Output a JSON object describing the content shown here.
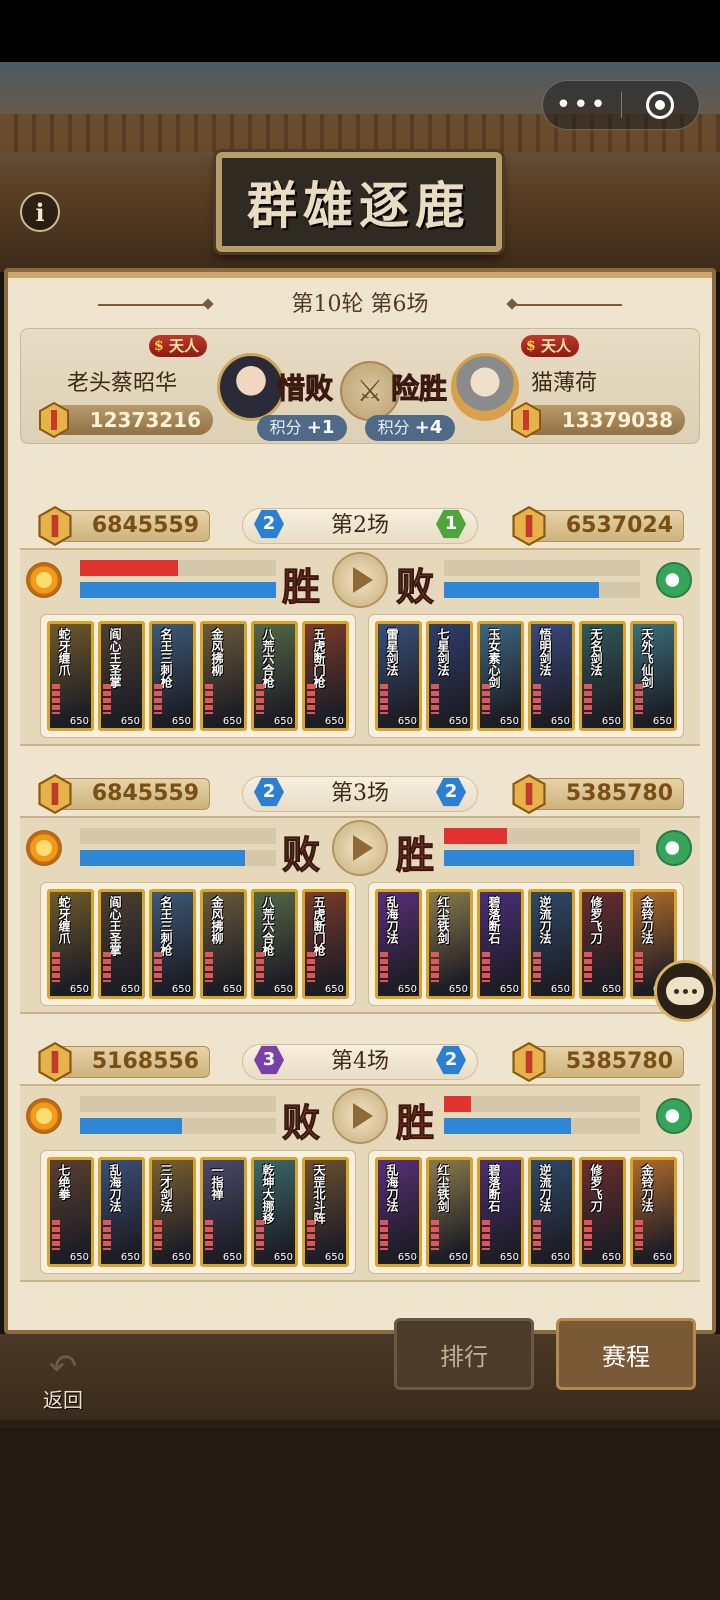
{
  "header": {
    "capsule_more": "•••",
    "sign_title": "群雄逐鹿",
    "info_icon": "i"
  },
  "summary": {
    "round_title": "第10轮 第6场",
    "left": {
      "rank": "天人",
      "name": "老头蔡昭华",
      "result": "惜败",
      "power": "12373216",
      "score_label": "积分",
      "score_value": "+1"
    },
    "right": {
      "rank": "天人",
      "name": "猫薄荷",
      "result": "险胜",
      "power": "13379038",
      "score_label": "积分",
      "score_value": "+4"
    },
    "vs_icon": "⚔"
  },
  "matches": [
    {
      "title": "第2场",
      "left_power": "6845559",
      "right_power": "6537024",
      "left_seed": "2",
      "right_seed": "1",
      "left_result": "胜",
      "right_result": "败",
      "left_hp": {
        "top": 0.5,
        "bottom": 1.0
      },
      "right_hp": {
        "top": 0,
        "bottom": 0.79
      },
      "left_team": [
        "蛇牙缠爪",
        "阎心王圣掌",
        "名王三刺枪",
        "金风拂柳",
        "八荒六合枪",
        "五虎断门枪"
      ],
      "right_team": [
        "雷星剑法",
        "七星剑法",
        "玉女素心剑",
        "悟明剑法",
        "无名剑法",
        "天外飞仙剑"
      ]
    },
    {
      "title": "第3场",
      "left_power": "6845559",
      "right_power": "5385780",
      "left_seed": "2",
      "right_seed": "2",
      "left_result": "败",
      "right_result": "胜",
      "left_hp": {
        "top": 0,
        "bottom": 0.84
      },
      "right_hp": {
        "top": 0.32,
        "bottom": 0.97
      },
      "left_team": [
        "蛇牙缠爪",
        "阎心王圣掌",
        "名王三刺枪",
        "金风拂柳",
        "八荒六合枪",
        "五虎断门枪"
      ],
      "right_team": [
        "乱海刀法",
        "红尘铁剑",
        "碧落断石",
        "逆流刀法",
        "修罗飞刀",
        "金铃刀法"
      ]
    },
    {
      "title": "第4场",
      "left_power": "5168556",
      "right_power": "5385780",
      "left_seed": "3",
      "right_seed": "2",
      "left_result": "败",
      "right_result": "胜",
      "left_hp": {
        "top": 0,
        "bottom": 0.52
      },
      "right_hp": {
        "top": 0.14,
        "bottom": 0.65
      },
      "left_team": [
        "七绝拳",
        "乱海刀法",
        "三才剑法",
        "一指禅",
        "乾坤大挪移",
        "天罡北斗阵"
      ],
      "right_team": [
        "乱海刀法",
        "红尘铁剑",
        "碧落断石",
        "逆流刀法",
        "修罗飞刀",
        "金铃刀法"
      ]
    }
  ],
  "card_level": "650",
  "footer": {
    "back_label": "返回",
    "tab_rank": "排行",
    "tab_schedule": "赛程"
  },
  "colors": {
    "hp_red": "#e0322e",
    "hp_blue": "#2d86d6",
    "frame_gold": "#d8a526",
    "panel_bg": "#efe5cf"
  }
}
